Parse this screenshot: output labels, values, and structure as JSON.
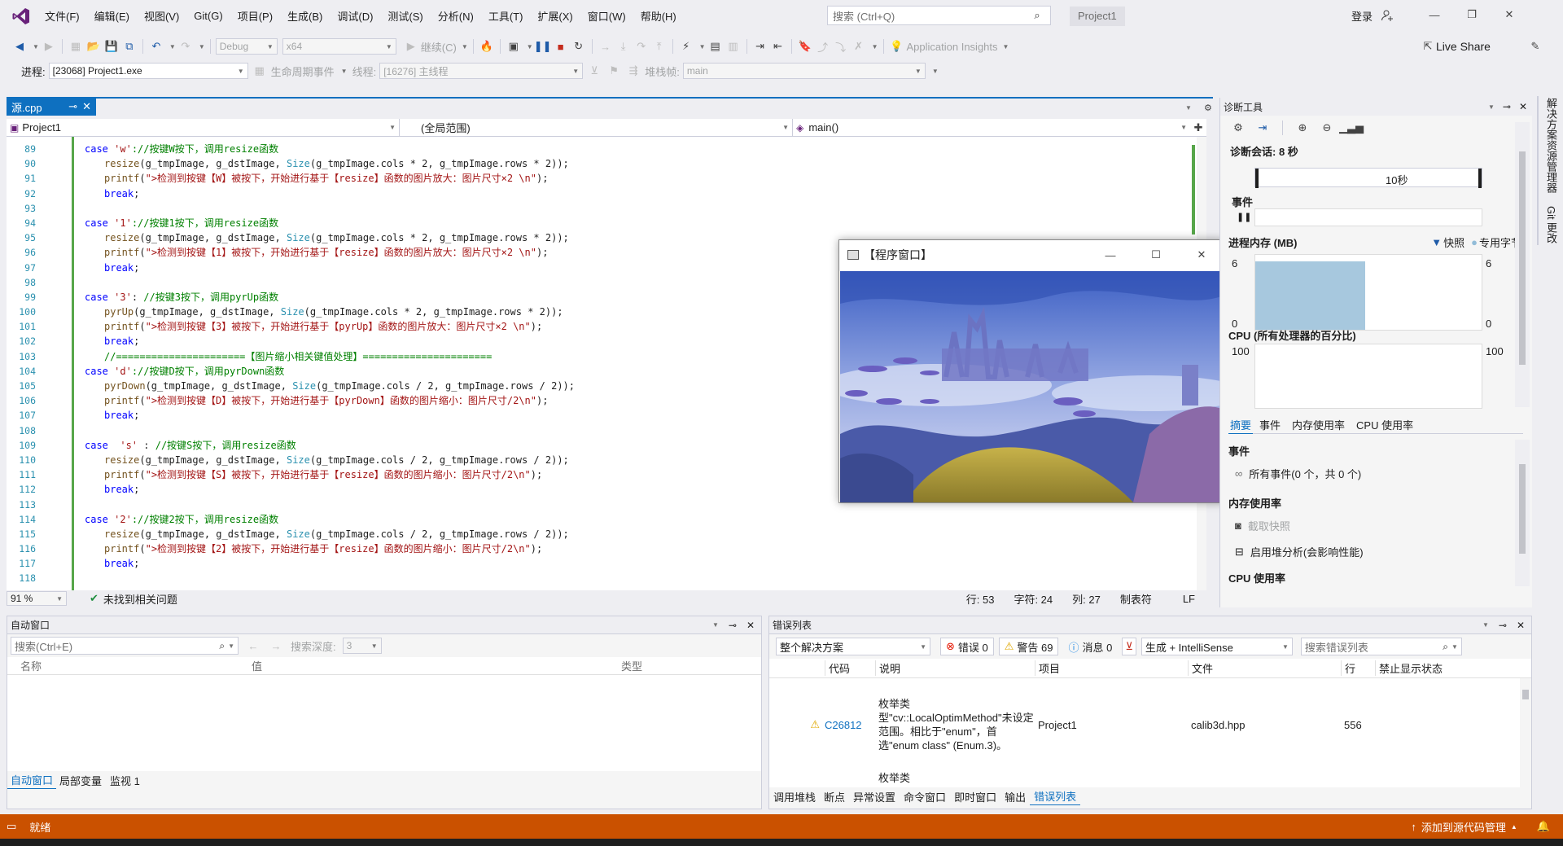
{
  "menu": [
    "文件(F)",
    "编辑(E)",
    "视图(V)",
    "Git(G)",
    "项目(P)",
    "生成(B)",
    "调试(D)",
    "测试(S)",
    "分析(N)",
    "工具(T)",
    "扩展(X)",
    "窗口(W)",
    "帮助(H)"
  ],
  "search": {
    "placeholder": "搜索 (Ctrl+Q)"
  },
  "project_badge": "Project1",
  "login": "登录",
  "toolbar": {
    "config": "Debug",
    "platform": "x64",
    "continue": "继续(C)",
    "app_insights": "Application Insights",
    "live_share": "Live Share"
  },
  "debugbar": {
    "process_label": "进程:",
    "process": "[23068] Project1.exe",
    "lifecycle": "生命周期事件",
    "thread_label": "线程:",
    "thread": "[16276] 主线程",
    "stack_label": "堆栈帧:",
    "stack": "main"
  },
  "editor": {
    "tab": "源.cpp",
    "project_scope": "Project1",
    "global_scope": "(全局范围)",
    "func_scope": "main()",
    "zoom": "91 %",
    "issues": "未找到相关问题",
    "status_line": "行: 53",
    "status_char": "字符: 24",
    "status_col": "列: 27",
    "status_tab": "制表符",
    "status_eol": "LF",
    "lines": [
      {
        "n": "89",
        "html": "<span class=\"kw\">case</span> <span class=\"str\">'w'</span><span class=\"cm\">://按键W按下，调用resize函数</span>",
        "indent": 2
      },
      {
        "n": "90",
        "html": "<span class=\"fn\">resize</span>(g_tmpImage, g_dstImage, <span class=\"ty\">Size</span>(g_tmpImage.cols * 2, g_tmpImage.rows * 2));",
        "indent": 3
      },
      {
        "n": "91",
        "html": "<span class=\"fn\">printf</span>(<span class=\"str\">\"&gt;检测到按键【W】被按下，开始进行基于【resize】函数的图片放大：图片尺寸×2 \\n\"</span>);",
        "indent": 3
      },
      {
        "n": "92",
        "html": "<span class=\"kw\">break</span>;",
        "indent": 3
      },
      {
        "n": "93",
        "html": "",
        "indent": 0
      },
      {
        "n": "94",
        "html": "<span class=\"kw\">case</span> <span class=\"str\">'1'</span><span class=\"cm\">://按键1按下，调用resize函数</span>",
        "indent": 2
      },
      {
        "n": "95",
        "html": "<span class=\"fn\">resize</span>(g_tmpImage, g_dstImage, <span class=\"ty\">Size</span>(g_tmpImage.cols * 2, g_tmpImage.rows * 2));",
        "indent": 3
      },
      {
        "n": "96",
        "html": "<span class=\"fn\">printf</span>(<span class=\"str\">\"&gt;检测到按键【1】被按下，开始进行基于【resize】函数的图片放大：图片尺寸×2 \\n\"</span>);",
        "indent": 3
      },
      {
        "n": "97",
        "html": "<span class=\"kw\">break</span>;",
        "indent": 3
      },
      {
        "n": "98",
        "html": "",
        "indent": 0
      },
      {
        "n": "99",
        "html": "<span class=\"kw\">case</span> <span class=\"str\">'3'</span>: <span class=\"cm\">//按键3按下，调用pyrUp函数</span>",
        "indent": 2
      },
      {
        "n": "100",
        "html": "<span class=\"fn\">pyrUp</span>(g_tmpImage, g_dstImage, <span class=\"ty\">Size</span>(g_tmpImage.cols * 2, g_tmpImage.rows * 2));",
        "indent": 3
      },
      {
        "n": "101",
        "html": "<span class=\"fn\">printf</span>(<span class=\"str\">\"&gt;检测到按键【3】被按下，开始进行基于【pyrUp】函数的图片放大：图片尺寸×2 \\n\"</span>);",
        "indent": 3
      },
      {
        "n": "102",
        "html": "<span class=\"kw\">break</span>;",
        "indent": 3
      },
      {
        "n": "103",
        "html": "<span class=\"cm\">//======================【图片缩小相关键值处理】======================</span>",
        "indent": 3
      },
      {
        "n": "104",
        "html": "<span class=\"kw\">case</span> <span class=\"str\">'d'</span><span class=\"cm\">://按键D按下，调用pyrDown函数</span>",
        "indent": 2
      },
      {
        "n": "105",
        "html": "<span class=\"fn\">pyrDown</span>(g_tmpImage, g_dstImage, <span class=\"ty\">Size</span>(g_tmpImage.cols / 2, g_tmpImage.rows / 2));",
        "indent": 3
      },
      {
        "n": "106",
        "html": "<span class=\"fn\">printf</span>(<span class=\"str\">\"&gt;检测到按键【D】被按下，开始进行基于【pyrDown】函数的图片缩小：图片尺寸/2\\n\"</span>);",
        "indent": 3
      },
      {
        "n": "107",
        "html": "<span class=\"kw\">break</span>;",
        "indent": 3
      },
      {
        "n": "108",
        "html": "",
        "indent": 0
      },
      {
        "n": "109",
        "html": "<span class=\"kw\">case</span>  <span class=\"str\">'s'</span> : <span class=\"cm\">//按键S按下，调用resize函数</span>",
        "indent": 2
      },
      {
        "n": "110",
        "html": "<span class=\"fn\">resize</span>(g_tmpImage, g_dstImage, <span class=\"ty\">Size</span>(g_tmpImage.cols / 2, g_tmpImage.rows / 2));",
        "indent": 3
      },
      {
        "n": "111",
        "html": "<span class=\"fn\">printf</span>(<span class=\"str\">\"&gt;检测到按键【S】被按下，开始进行基于【resize】函数的图片缩小：图片尺寸/2\\n\"</span>);",
        "indent": 3
      },
      {
        "n": "112",
        "html": "<span class=\"kw\">break</span>;",
        "indent": 3
      },
      {
        "n": "113",
        "html": "",
        "indent": 0
      },
      {
        "n": "114",
        "html": "<span class=\"kw\">case</span> <span class=\"str\">'2'</span><span class=\"cm\">://按键2按下，调用resize函数</span>",
        "indent": 2
      },
      {
        "n": "115",
        "html": "<span class=\"fn\">resize</span>(g_tmpImage, g_dstImage, <span class=\"ty\">Size</span>(g_tmpImage.cols / 2, g_tmpImage.rows / 2));",
        "indent": 3
      },
      {
        "n": "116",
        "html": "<span class=\"fn\">printf</span>(<span class=\"str\">\"&gt;检测到按键【2】被按下，开始进行基于【resize】函数的图片缩小：图片尺寸/2\\n\"</span>);",
        "indent": 3
      },
      {
        "n": "117",
        "html": "<span class=\"kw\">break</span>;",
        "indent": 3
      },
      {
        "n": "118",
        "html": "",
        "indent": 0
      }
    ]
  },
  "program_window": {
    "title": "【程序窗口】"
  },
  "diag": {
    "title": "诊断工具",
    "session": "诊断会话: 8 秒",
    "timeline_label": "10秒",
    "events": "事件",
    "memory": "进程内存 (MB)",
    "snapshot": "快照",
    "private_bytes": "专用字节",
    "mem_max": "6",
    "mem_min": "0",
    "cpu": "CPU (所有处理器的百分比)",
    "cpu_max": "100",
    "tabs": [
      "摘要",
      "事件",
      "内存使用率",
      "CPU 使用率"
    ],
    "sec_events": "事件",
    "all_events": "所有事件(0 个，共 0 个)",
    "sec_memory": "内存使用率",
    "take_snapshot": "截取快照",
    "heap_analysis": "启用堆分析(会影响性能)",
    "sec_cpu": "CPU 使用率"
  },
  "right_rail": [
    "解决方案资源管理器",
    "Git 更改"
  ],
  "auto": {
    "title": "自动窗口",
    "search_placeholder": "搜索(Ctrl+E)",
    "depth_label": "搜索深度:",
    "depth": "3",
    "cols": [
      "名称",
      "值",
      "类型"
    ],
    "tabs": [
      "自动窗口",
      "局部变量",
      "监视 1"
    ]
  },
  "errors": {
    "title": "错误列表",
    "scope": "整个解决方案",
    "err": "错误 0",
    "warn": "警告 69",
    "msg": "消息 0",
    "build": "生成 + IntelliSense",
    "search_placeholder": "搜索错误列表",
    "cols": [
      "代码",
      "说明",
      "项目",
      "文件",
      "行",
      "禁止显示状态"
    ],
    "row": {
      "code": "C26812",
      "desc": "枚举类型\"cv::LocalOptimMethod\"未设定范围。相比于\"enum\"，首选\"enum class\" (Enum.3)。",
      "project": "Project1",
      "file": "calib3d.hpp",
      "line": "556"
    },
    "next_desc": "枚举类",
    "tabs": [
      "调用堆栈",
      "断点",
      "异常设置",
      "命令窗口",
      "即时窗口",
      "输出",
      "错误列表"
    ]
  },
  "statusbar": {
    "ready": "就绪",
    "source_control": "添加到源代码管理"
  },
  "colors": {
    "accent": "#0e70c0",
    "status_bar": "#ca5100",
    "warning": "#f0c000",
    "error": "#e51400",
    "info": "#1e88e5"
  }
}
